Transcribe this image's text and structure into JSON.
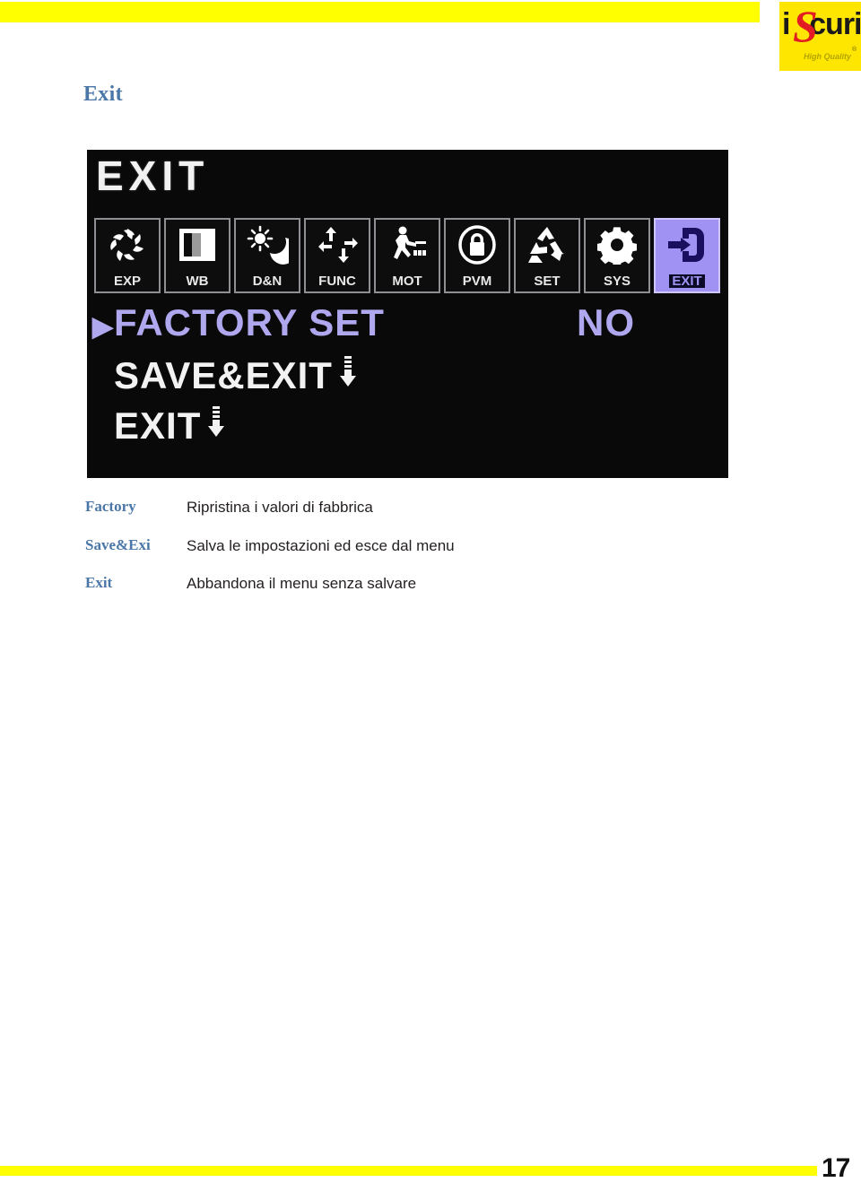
{
  "header": {
    "logo": {
      "prefix": "i",
      "accent": "S",
      "suffix": "curi",
      "tagline": "High Quality",
      "registered": "®",
      "bar_color": "#ffff00",
      "logo_bg": "#ffe600",
      "accent_color": "#e31c23"
    }
  },
  "page": {
    "title": "Exit",
    "title_color": "#4a77a8",
    "number": "17"
  },
  "osd": {
    "title": "EXIT",
    "background": "#090909",
    "highlight_color": "#b0a8ee",
    "text_color": "#f2f2f2",
    "icons": [
      {
        "label": "EXP",
        "icon": "iris-aperture-icon",
        "selected": false
      },
      {
        "label": "WB",
        "icon": "white-balance-icon",
        "selected": false
      },
      {
        "label": "D&N",
        "icon": "day-night-icon",
        "selected": false
      },
      {
        "label": "FUNC",
        "icon": "four-arrows-icon",
        "selected": false
      },
      {
        "label": "MOT",
        "icon": "motion-person-icon",
        "selected": false
      },
      {
        "label": "PVM",
        "icon": "privacy-lock-icon",
        "selected": false
      },
      {
        "label": "SET",
        "icon": "recycle-set-icon",
        "selected": false
      },
      {
        "label": "SYS",
        "icon": "gear-icon",
        "selected": false
      },
      {
        "label": "EXIT",
        "icon": "exit-door-icon",
        "selected": true
      }
    ],
    "menu": [
      {
        "caret": "▶",
        "label": "FACTORY SET",
        "value": "NO",
        "active": true,
        "submenu": false
      },
      {
        "caret": "",
        "label": "SAVE&EXIT",
        "value": "",
        "active": false,
        "submenu": true
      },
      {
        "caret": "",
        "label": "EXIT",
        "value": "",
        "active": false,
        "submenu": true
      }
    ]
  },
  "descriptions": [
    {
      "term": "Factory",
      "text": "Ripristina i valori di fabbrica"
    },
    {
      "term": "Save&Exi",
      "text": "Salva le impostazioni ed esce dal menu"
    },
    {
      "term": "Exit",
      "text": "Abbandona il menu senza salvare"
    }
  ]
}
